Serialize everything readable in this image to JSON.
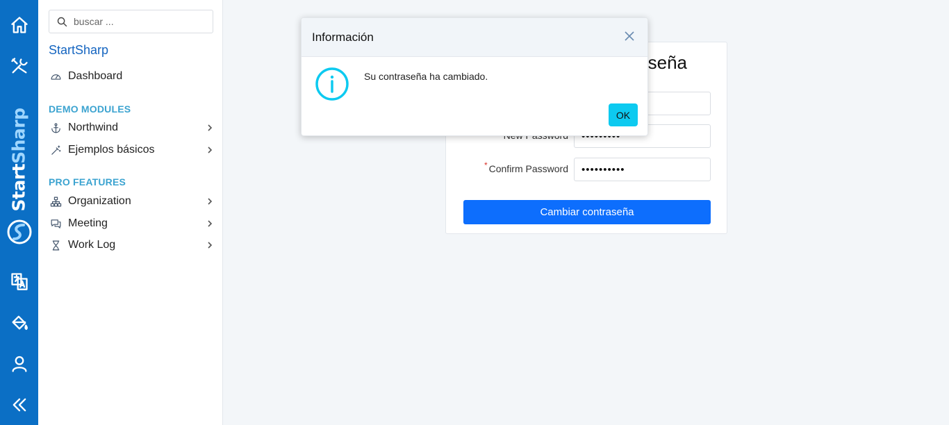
{
  "rail": {
    "logo_text_main": "Start",
    "logo_text_alt": "Sharp",
    "icons": [
      "home-icon",
      "tools-icon",
      "language-icon",
      "theme-paint-icon",
      "user-icon",
      "collapse-icon"
    ]
  },
  "sidebar": {
    "search_placeholder": "buscar ...",
    "brand": "StartSharp",
    "dashboard_label": "Dashboard",
    "section_demo": "DEMO MODULES",
    "northwind_label": "Northwind",
    "ejemplos_label": "Ejemplos básicos",
    "section_pro": "PRO FEATURES",
    "organization_label": "Organization",
    "meeting_label": "Meeting",
    "worklog_label": "Work Log"
  },
  "form": {
    "title": "seña",
    "new_password_label": "New Password",
    "new_password_value": "•••••••••",
    "confirm_password_label": "Confirm Password",
    "confirm_password_value": "••••••••••",
    "submit_label": "Cambiar contraseña"
  },
  "dialog": {
    "title": "Información",
    "message": "Su contraseña ha cambiado.",
    "ok_label": "OK"
  },
  "colors": {
    "rail": "#0b6fc5",
    "brand": "#1565c0",
    "section": "#3ba3d0",
    "primary_button": "#0d6efd",
    "info": "#0dcaf0"
  }
}
